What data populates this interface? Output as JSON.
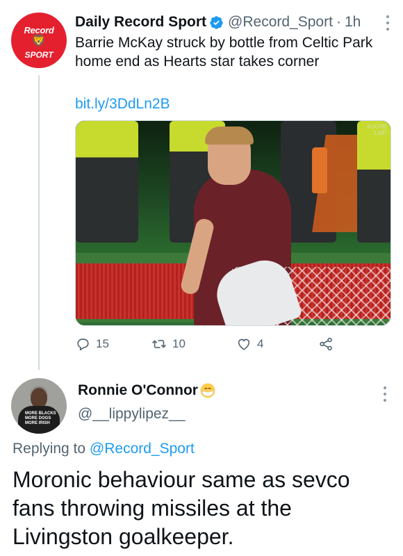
{
  "tweet": {
    "author": {
      "display_name": "Daily Record Sport",
      "handle": "@Record_Sport",
      "separator": "·",
      "time": "1h",
      "avatar_text_top": "Record",
      "avatar_text_bottom": "SPORT",
      "verified": true
    },
    "text": "Barrie McKay struck by bottle from Celtic Park home end as Hearts star takes corner",
    "link": "bit.ly/3DdLn2B",
    "media": {
      "watermark_line1": "FOOTB",
      "watermark_line2": "LIVE"
    },
    "actions": {
      "reply_count": "15",
      "retweet_count": "10",
      "like_count": "4"
    }
  },
  "reply": {
    "author": {
      "display_name": "Ronnie O'Connor",
      "handle": "@__lippylipez__",
      "avatar_shirt_text": "MORE BLACKS MORE DOGS MORE IRISH"
    },
    "replying_to_prefix": "Replying to",
    "replying_to_mention": "@Record_Sport",
    "text": "Moronic behaviour same as sevco fans throwing missiles at the Livingston goalkeeper."
  },
  "colors": {
    "link_blue": "#1d9bf0",
    "secondary_gray": "#536471",
    "brand_red": "#e4202f",
    "verified_blue": "#1d9bf0"
  },
  "icons": [
    "verified-badge-icon",
    "more-options-icon",
    "reply-icon",
    "retweet-icon",
    "like-icon",
    "share-icon",
    "face-with-medical-mask-emoji"
  ]
}
